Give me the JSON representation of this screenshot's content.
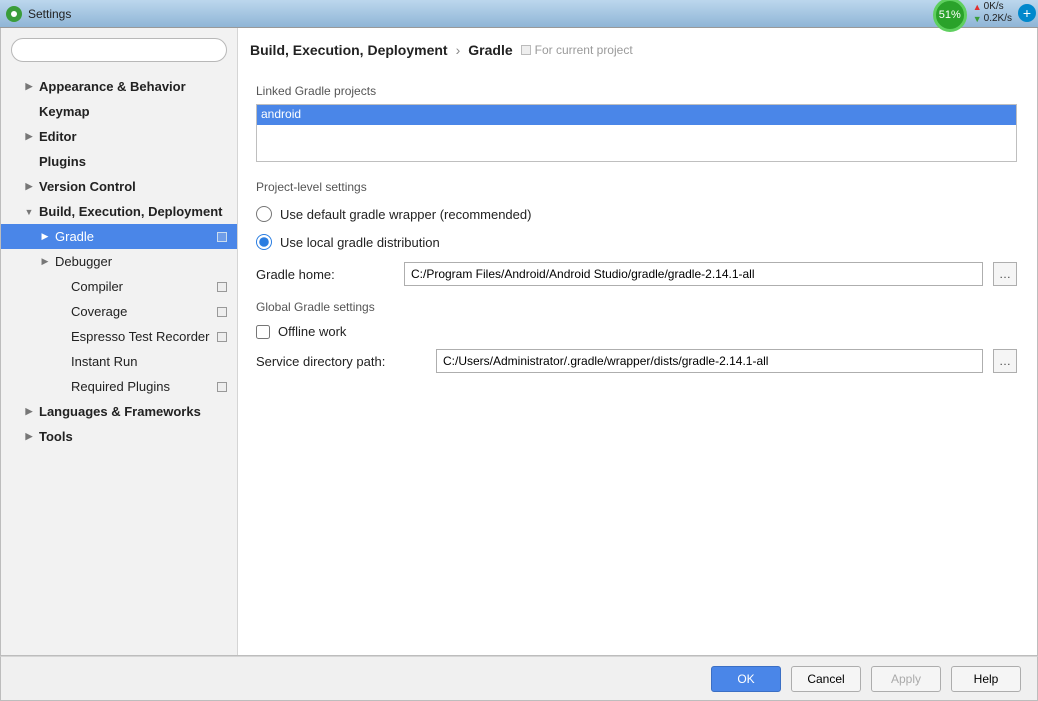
{
  "window": {
    "title": "Settings"
  },
  "status": {
    "percent": "51%",
    "up": "0K/s",
    "down": "0.2K/s"
  },
  "sidebar": {
    "search_placeholder": "",
    "items": [
      {
        "label": "Appearance & Behavior",
        "arrow": "▶",
        "bold": true,
        "depth": 1
      },
      {
        "label": "Keymap",
        "bold": true,
        "depth": 1,
        "noarrow": true
      },
      {
        "label": "Editor",
        "arrow": "▶",
        "bold": true,
        "depth": 1
      },
      {
        "label": "Plugins",
        "bold": true,
        "depth": 1,
        "noarrow": true
      },
      {
        "label": "Version Control",
        "arrow": "▶",
        "bold": true,
        "depth": 1
      },
      {
        "label": "Build, Execution, Deployment",
        "arrow": "▼",
        "bold": true,
        "depth": 1
      },
      {
        "label": "Gradle",
        "arrow": "▶",
        "depth": 2,
        "selected": true,
        "badge": true
      },
      {
        "label": "Debugger",
        "arrow": "▶",
        "depth": 2
      },
      {
        "label": "Compiler",
        "depth": 3,
        "noarrow": true,
        "badge": true
      },
      {
        "label": "Coverage",
        "depth": 3,
        "noarrow": true,
        "badge": true
      },
      {
        "label": "Espresso Test Recorder",
        "depth": 3,
        "noarrow": true,
        "badge": true
      },
      {
        "label": "Instant Run",
        "depth": 3,
        "noarrow": true
      },
      {
        "label": "Required Plugins",
        "depth": 3,
        "noarrow": true,
        "badge": true
      },
      {
        "label": "Languages & Frameworks",
        "arrow": "▶",
        "bold": true,
        "depth": 1
      },
      {
        "label": "Tools",
        "arrow": "▶",
        "bold": true,
        "depth": 1
      }
    ]
  },
  "breadcrumb": {
    "parent": "Build, Execution, Deployment",
    "child": "Gradle",
    "hint": "For current project"
  },
  "linked": {
    "label": "Linked Gradle projects",
    "items": [
      "android"
    ]
  },
  "project_level": {
    "label": "Project-level settings",
    "radio_default": "Use default gradle wrapper (recommended)",
    "radio_local": "Use local gradle distribution",
    "gradle_home_label": "Gradle home:",
    "gradle_home_value": "C:/Program Files/Android/Android Studio/gradle/gradle-2.14.1-all"
  },
  "global": {
    "label": "Global Gradle settings",
    "offline": "Offline work",
    "service_dir_label": "Service directory path:",
    "service_dir_value": "C:/Users/Administrator/.gradle/wrapper/dists/gradle-2.14.1-all"
  },
  "footer": {
    "ok": "OK",
    "cancel": "Cancel",
    "apply": "Apply",
    "help": "Help"
  }
}
